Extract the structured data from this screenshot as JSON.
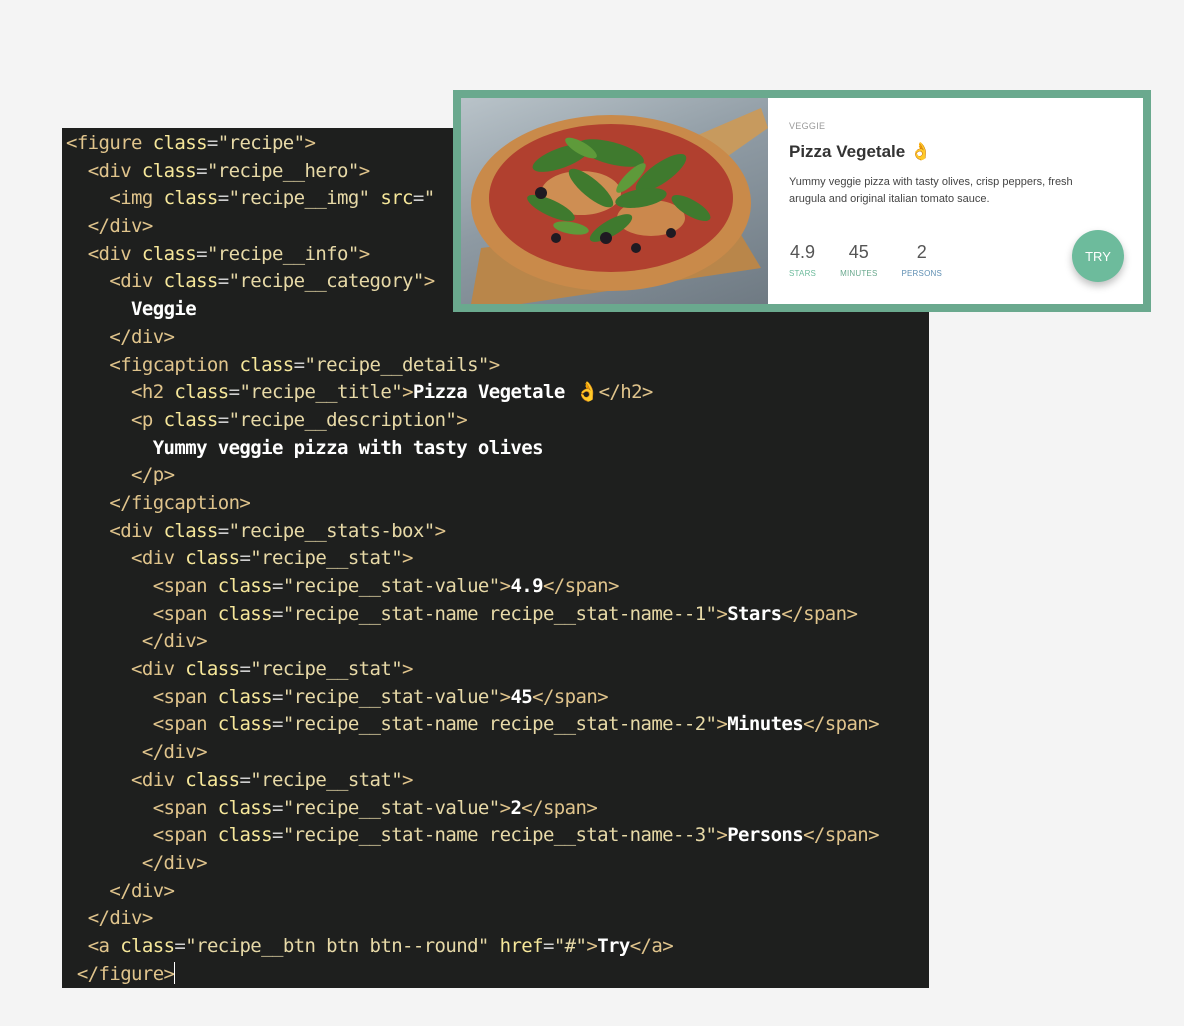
{
  "editor": {
    "lines": [
      [
        {
          "t": "tag",
          "v": "<figure"
        },
        {
          "t": "punc",
          "v": " "
        },
        {
          "t": "attr",
          "v": "class"
        },
        {
          "t": "punc",
          "v": "="
        },
        {
          "t": "str",
          "v": "\"recipe\""
        },
        {
          "t": "tag",
          "v": ">"
        }
      ],
      [
        {
          "t": "punc",
          "v": "  "
        },
        {
          "t": "tag",
          "v": "<div"
        },
        {
          "t": "punc",
          "v": " "
        },
        {
          "t": "attr",
          "v": "class"
        },
        {
          "t": "punc",
          "v": "="
        },
        {
          "t": "str",
          "v": "\"recipe__hero\""
        },
        {
          "t": "tag",
          "v": ">"
        }
      ],
      [
        {
          "t": "punc",
          "v": "    "
        },
        {
          "t": "tag",
          "v": "<img"
        },
        {
          "t": "punc",
          "v": " "
        },
        {
          "t": "attr",
          "v": "class"
        },
        {
          "t": "punc",
          "v": "="
        },
        {
          "t": "str",
          "v": "\"recipe__img\""
        },
        {
          "t": "punc",
          "v": " "
        },
        {
          "t": "attr",
          "v": "src"
        },
        {
          "t": "punc",
          "v": "="
        },
        {
          "t": "str",
          "v": "\""
        }
      ],
      [
        {
          "t": "punc",
          "v": "  "
        },
        {
          "t": "tag",
          "v": "</div>"
        }
      ],
      [
        {
          "t": "punc",
          "v": "  "
        },
        {
          "t": "tag",
          "v": "<div"
        },
        {
          "t": "punc",
          "v": " "
        },
        {
          "t": "attr",
          "v": "class"
        },
        {
          "t": "punc",
          "v": "="
        },
        {
          "t": "str",
          "v": "\"recipe__info\""
        },
        {
          "t": "tag",
          "v": ">"
        }
      ],
      [
        {
          "t": "punc",
          "v": "    "
        },
        {
          "t": "tag",
          "v": "<div"
        },
        {
          "t": "punc",
          "v": " "
        },
        {
          "t": "attr",
          "v": "class"
        },
        {
          "t": "punc",
          "v": "="
        },
        {
          "t": "str",
          "v": "\"recipe__category\""
        },
        {
          "t": "tag",
          "v": ">"
        }
      ],
      [
        {
          "t": "punc",
          "v": "      "
        },
        {
          "t": "text",
          "v": "Veggie"
        }
      ],
      [
        {
          "t": "punc",
          "v": "    "
        },
        {
          "t": "tag",
          "v": "</div>"
        }
      ],
      [
        {
          "t": "punc",
          "v": "    "
        },
        {
          "t": "tag",
          "v": "<figcaption"
        },
        {
          "t": "punc",
          "v": " "
        },
        {
          "t": "attr",
          "v": "class"
        },
        {
          "t": "punc",
          "v": "="
        },
        {
          "t": "str",
          "v": "\"recipe__details\""
        },
        {
          "t": "tag",
          "v": ">"
        }
      ],
      [
        {
          "t": "punc",
          "v": "      "
        },
        {
          "t": "tag",
          "v": "<h2"
        },
        {
          "t": "punc",
          "v": " "
        },
        {
          "t": "attr",
          "v": "class"
        },
        {
          "t": "punc",
          "v": "="
        },
        {
          "t": "str",
          "v": "\"recipe__title\""
        },
        {
          "t": "tag",
          "v": ">"
        },
        {
          "t": "text",
          "v": "Pizza Vegetale 👌"
        },
        {
          "t": "tag",
          "v": "</h2>"
        }
      ],
      [
        {
          "t": "punc",
          "v": "      "
        },
        {
          "t": "tag",
          "v": "<p"
        },
        {
          "t": "punc",
          "v": " "
        },
        {
          "t": "attr",
          "v": "class"
        },
        {
          "t": "punc",
          "v": "="
        },
        {
          "t": "str",
          "v": "\"recipe__description\""
        },
        {
          "t": "tag",
          "v": ">"
        }
      ],
      [
        {
          "t": "punc",
          "v": "        "
        },
        {
          "t": "text",
          "v": "Yummy veggie pizza with tasty olives"
        }
      ],
      [
        {
          "t": "punc",
          "v": "      "
        },
        {
          "t": "tag",
          "v": "</p>"
        }
      ],
      [
        {
          "t": "punc",
          "v": "    "
        },
        {
          "t": "tag",
          "v": "</figcaption>"
        }
      ],
      [
        {
          "t": "punc",
          "v": "    "
        },
        {
          "t": "tag",
          "v": "<div"
        },
        {
          "t": "punc",
          "v": " "
        },
        {
          "t": "attr",
          "v": "class"
        },
        {
          "t": "punc",
          "v": "="
        },
        {
          "t": "str",
          "v": "\"recipe__stats-box\""
        },
        {
          "t": "tag",
          "v": ">"
        }
      ],
      [
        {
          "t": "punc",
          "v": "      "
        },
        {
          "t": "tag",
          "v": "<div"
        },
        {
          "t": "punc",
          "v": " "
        },
        {
          "t": "attr",
          "v": "class"
        },
        {
          "t": "punc",
          "v": "="
        },
        {
          "t": "str",
          "v": "\"recipe__stat\""
        },
        {
          "t": "tag",
          "v": ">"
        }
      ],
      [
        {
          "t": "punc",
          "v": "        "
        },
        {
          "t": "tag",
          "v": "<span"
        },
        {
          "t": "punc",
          "v": " "
        },
        {
          "t": "attr",
          "v": "class"
        },
        {
          "t": "punc",
          "v": "="
        },
        {
          "t": "str",
          "v": "\"recipe__stat-value\""
        },
        {
          "t": "tag",
          "v": ">"
        },
        {
          "t": "text",
          "v": "4.9"
        },
        {
          "t": "tag",
          "v": "</span>"
        }
      ],
      [
        {
          "t": "punc",
          "v": "        "
        },
        {
          "t": "tag",
          "v": "<span"
        },
        {
          "t": "punc",
          "v": " "
        },
        {
          "t": "attr",
          "v": "class"
        },
        {
          "t": "punc",
          "v": "="
        },
        {
          "t": "str",
          "v": "\"recipe__stat-name recipe__stat-name--1\""
        },
        {
          "t": "tag",
          "v": ">"
        },
        {
          "t": "text",
          "v": "Stars"
        },
        {
          "t": "tag",
          "v": "</span>"
        }
      ],
      [
        {
          "t": "punc",
          "v": "       "
        },
        {
          "t": "tag",
          "v": "</div>"
        }
      ],
      [
        {
          "t": "punc",
          "v": "      "
        },
        {
          "t": "tag",
          "v": "<div"
        },
        {
          "t": "punc",
          "v": " "
        },
        {
          "t": "attr",
          "v": "class"
        },
        {
          "t": "punc",
          "v": "="
        },
        {
          "t": "str",
          "v": "\"recipe__stat\""
        },
        {
          "t": "tag",
          "v": ">"
        }
      ],
      [
        {
          "t": "punc",
          "v": "        "
        },
        {
          "t": "tag",
          "v": "<span"
        },
        {
          "t": "punc",
          "v": " "
        },
        {
          "t": "attr",
          "v": "class"
        },
        {
          "t": "punc",
          "v": "="
        },
        {
          "t": "str",
          "v": "\"recipe__stat-value\""
        },
        {
          "t": "tag",
          "v": ">"
        },
        {
          "t": "text",
          "v": "45"
        },
        {
          "t": "tag",
          "v": "</span>"
        }
      ],
      [
        {
          "t": "punc",
          "v": "        "
        },
        {
          "t": "tag",
          "v": "<span"
        },
        {
          "t": "punc",
          "v": " "
        },
        {
          "t": "attr",
          "v": "class"
        },
        {
          "t": "punc",
          "v": "="
        },
        {
          "t": "str",
          "v": "\"recipe__stat-name recipe__stat-name--2\""
        },
        {
          "t": "tag",
          "v": ">"
        },
        {
          "t": "text",
          "v": "Minutes"
        },
        {
          "t": "tag",
          "v": "</span>"
        }
      ],
      [
        {
          "t": "punc",
          "v": "       "
        },
        {
          "t": "tag",
          "v": "</div>"
        }
      ],
      [
        {
          "t": "punc",
          "v": "      "
        },
        {
          "t": "tag",
          "v": "<div"
        },
        {
          "t": "punc",
          "v": " "
        },
        {
          "t": "attr",
          "v": "class"
        },
        {
          "t": "punc",
          "v": "="
        },
        {
          "t": "str",
          "v": "\"recipe__stat\""
        },
        {
          "t": "tag",
          "v": ">"
        }
      ],
      [
        {
          "t": "punc",
          "v": "        "
        },
        {
          "t": "tag",
          "v": "<span"
        },
        {
          "t": "punc",
          "v": " "
        },
        {
          "t": "attr",
          "v": "class"
        },
        {
          "t": "punc",
          "v": "="
        },
        {
          "t": "str",
          "v": "\"recipe__stat-value\""
        },
        {
          "t": "tag",
          "v": ">"
        },
        {
          "t": "text",
          "v": "2"
        },
        {
          "t": "tag",
          "v": "</span>"
        }
      ],
      [
        {
          "t": "punc",
          "v": "        "
        },
        {
          "t": "tag",
          "v": "<span"
        },
        {
          "t": "punc",
          "v": " "
        },
        {
          "t": "attr",
          "v": "class"
        },
        {
          "t": "punc",
          "v": "="
        },
        {
          "t": "str",
          "v": "\"recipe__stat-name recipe__stat-name--3\""
        },
        {
          "t": "tag",
          "v": ">"
        },
        {
          "t": "text",
          "v": "Persons"
        },
        {
          "t": "tag",
          "v": "</span>"
        }
      ],
      [
        {
          "t": "punc",
          "v": "       "
        },
        {
          "t": "tag",
          "v": "</div>"
        }
      ],
      [
        {
          "t": "punc",
          "v": "    "
        },
        {
          "t": "tag",
          "v": "</div>"
        }
      ],
      [
        {
          "t": "punc",
          "v": "  "
        },
        {
          "t": "tag",
          "v": "</div>"
        }
      ],
      [
        {
          "t": "punc",
          "v": "  "
        },
        {
          "t": "tag",
          "v": "<a"
        },
        {
          "t": "punc",
          "v": " "
        },
        {
          "t": "attr",
          "v": "class"
        },
        {
          "t": "punc",
          "v": "="
        },
        {
          "t": "str",
          "v": "\"recipe__btn btn btn--round\""
        },
        {
          "t": "punc",
          "v": " "
        },
        {
          "t": "attr",
          "v": "href"
        },
        {
          "t": "punc",
          "v": "="
        },
        {
          "t": "str",
          "v": "\"#\""
        },
        {
          "t": "tag",
          "v": ">"
        },
        {
          "t": "text",
          "v": "Try"
        },
        {
          "t": "tag",
          "v": "</a>"
        }
      ],
      [
        {
          "t": "punc",
          "v": " "
        },
        {
          "t": "tag",
          "v": "</figure>"
        }
      ]
    ]
  },
  "card": {
    "category": "VEGGIE",
    "title": "Pizza Vegetale 👌",
    "description": "Yummy veggie pizza with tasty olives, crisp peppers, fresh arugula and original italian tomato sauce.",
    "stats": [
      {
        "value": "4.9",
        "name": "STARS",
        "color": "#6dbb9c"
      },
      {
        "value": "45",
        "name": "MINUTES",
        "color": "#6aa98e"
      },
      {
        "value": "2",
        "name": "PERSONS",
        "color": "#5f8fb3"
      }
    ],
    "button_label": "TRY"
  },
  "colors": {
    "frame": "#6aa98e",
    "button": "#6dbb9c",
    "editor_bg": "#1e1f1e"
  },
  "icons": [
    "pizza-image"
  ]
}
